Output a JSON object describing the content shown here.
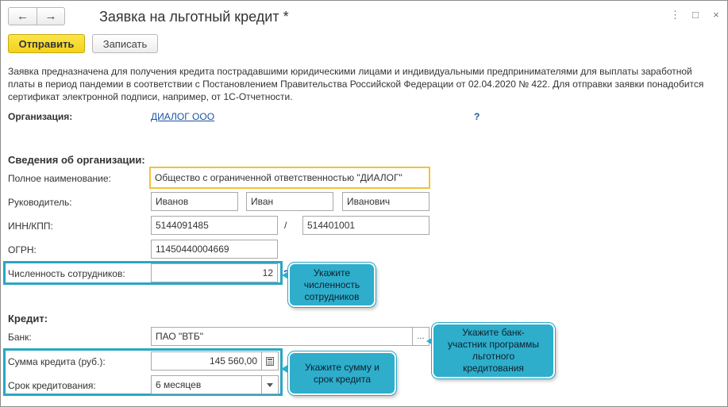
{
  "window": {
    "title": "Заявка на льготный кредит *",
    "nav_back": "←",
    "nav_forward": "→",
    "more": "⋮",
    "maximize": "□",
    "close": "×"
  },
  "toolbar": {
    "send_label": "Отправить",
    "save_label": "Записать"
  },
  "description": "Заявка предназначена для получения кредита пострадавшими юридическими лицами и индивидуальными предпринимателями для выплаты заработной платы в период пандемии в соответствии с Постановлением Правительства Российской Федерации от 02.04.2020 № 422. Для отправки заявки понадобится сертификат электронной подписи, например, от 1С-Отчетности.",
  "organization": {
    "label": "Организация:",
    "value": "ДИАЛОГ ООО",
    "help": "?"
  },
  "org_info": {
    "section_title": "Сведения об организации:",
    "full_name_label": "Полное наименование:",
    "full_name": "Общество с ограниченной ответственностью \"ДИАЛОГ\"",
    "head_label": "Руководитель:",
    "last_name": "Иванов",
    "first_name": "Иван",
    "middle_name": "Иванович",
    "inn_kpp_label": "ИНН/КПП:",
    "inn": "5144091485",
    "slash": "/",
    "kpp": "514401001",
    "ogrn_label": "ОГРН:",
    "ogrn": "11450440004669",
    "employees_label": "Численность сотрудников:",
    "employees": "12",
    "employees_help": "?"
  },
  "credit": {
    "section_title": "Кредит:",
    "bank_label": "Банк:",
    "bank": "ПАО \"ВТБ\"",
    "bank_select": "...",
    "amount_label": "Сумма кредита (руб.):",
    "amount": "145 560,00",
    "term_label": "Срок кредитования:",
    "term": "6 месяцев"
  },
  "callouts": {
    "employees": "Укажите\nчисленность\nсотрудников",
    "bank": "Укажите банк-\nучастник программы\nльготного\nкредитования",
    "amount": "Укажите сумму и\nсрок кредита"
  },
  "colors": {
    "accent_button": "#f3d21b",
    "focus_border": "#f5c13a",
    "highlight": "#2aa6c4",
    "link": "#1a54a0"
  }
}
